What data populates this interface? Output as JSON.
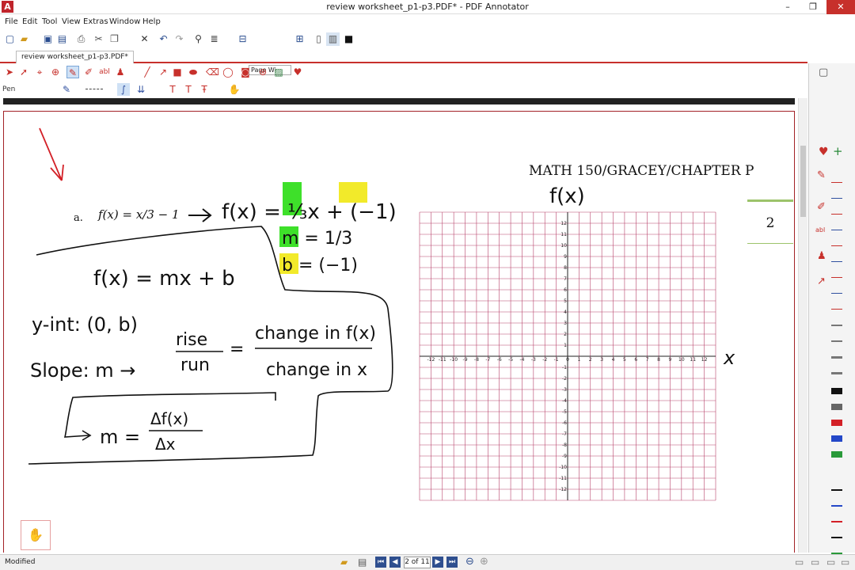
{
  "window": {
    "app_icon": "A",
    "title": "review worksheet_p1-p3.PDF* - PDF Annotator",
    "minimize": "–",
    "maximize": "❐",
    "close": "✕"
  },
  "menu": [
    "File",
    "Edit",
    "Tool",
    "View",
    "Extras",
    "Window",
    "Help"
  ],
  "toolbar1": {
    "zoom_label": "Page Wi",
    "icons": [
      "new-icon",
      "open-icon",
      "save-icon",
      "save-as-icon",
      "print-icon",
      "cut-icon",
      "copy-icon",
      "delete-icon",
      "undo-icon",
      "redo-icon",
      "find-icon",
      "zoom-out-icon",
      "zoom-in-icon",
      "single-page-icon",
      "two-page-icon",
      "fullscreen-icon"
    ]
  },
  "tab": {
    "label": "review worksheet_p1-p3.PDF*"
  },
  "tools": {
    "active_tool": "Pen",
    "icons": [
      "select-icon",
      "select-text-icon",
      "zoom-tool-icon",
      "pen-tool-icon",
      "marker-icon",
      "text-icon",
      "stamp-icon",
      "line-icon",
      "arrow-icon",
      "rectangle-icon",
      "ellipse-icon",
      "eraser-icon",
      "lasso-icon",
      "camera-icon",
      "image-icon",
      "favorites-icon"
    ]
  },
  "page": {
    "header": "MATH 150/GRACEY/CHAPTER P",
    "page_number": "2",
    "example_label": "a.",
    "example_equation": "f(x) = x/3 − 1"
  },
  "handwriting": {
    "line1": "f(x) = ⅓x + (−1)",
    "slope_m": "m = 1/3",
    "intercept_b": "b = (−1)",
    "formula": "f(x) = mx + b",
    "yint": "y-int: (0, b)",
    "slope_prefix": "Slope:  m →",
    "rise": "rise",
    "run": "run",
    "change_fx": "change in f(x)",
    "change_x": "change in x",
    "delta_formula": "m =",
    "delta_fx": "Δf(x)",
    "delta_x": "Δx",
    "graph_y_label": "f(x)",
    "graph_x_label": "x"
  },
  "grid": {
    "x_ticks": [
      "-12",
      "-11",
      "-10",
      "-9",
      "-8",
      "-7",
      "-6",
      "-5",
      "-4",
      "-3",
      "-2",
      "-1",
      "0",
      "1",
      "2",
      "3",
      "4",
      "5",
      "6",
      "7",
      "8",
      "9",
      "10",
      "11",
      "12"
    ],
    "y_ticks": [
      "12",
      "11",
      "10",
      "9",
      "8",
      "7",
      "6",
      "5",
      "4",
      "3",
      "2",
      "1",
      "0",
      "-1",
      "-2",
      "-3",
      "-4",
      "-5",
      "-6",
      "-7",
      "-8",
      "-9",
      "-10",
      "-11",
      "-12"
    ],
    "line_color": "#b8436b"
  },
  "status": {
    "text": "Modified",
    "page_indicator": "2 of 11"
  }
}
